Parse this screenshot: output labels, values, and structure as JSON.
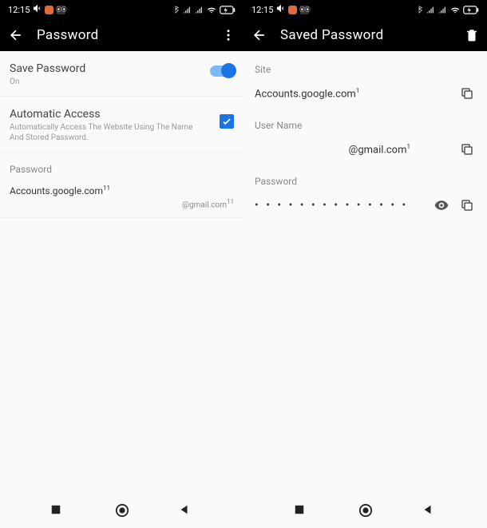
{
  "status": {
    "time": "12:15",
    "right_icons": "✱ ⁴ᴳ .ıll .ıll ᯤ ⏵",
    "battery": "⚡"
  },
  "left": {
    "title": "Password",
    "save_password": {
      "title": "Save Password",
      "desc": "On"
    },
    "auto_access": {
      "title": "Automatic Access",
      "desc": "Automatically Access The Website Using The Name And Stored Password."
    },
    "password_header": "Password",
    "item": {
      "site": "Accounts.google.com",
      "site_sup": "11",
      "user_suffix": "@gmail.com",
      "user_sup": "11"
    }
  },
  "right": {
    "title": "Saved Password",
    "site_label": "Site",
    "site_value": "Accounts.google.com",
    "site_sup": "1",
    "user_label": "User Name",
    "user_value_suffix": "@gmail.com",
    "user_sup": "1",
    "password_label": "Password",
    "password_mask": "• • • • • • • • • • • • • •"
  }
}
